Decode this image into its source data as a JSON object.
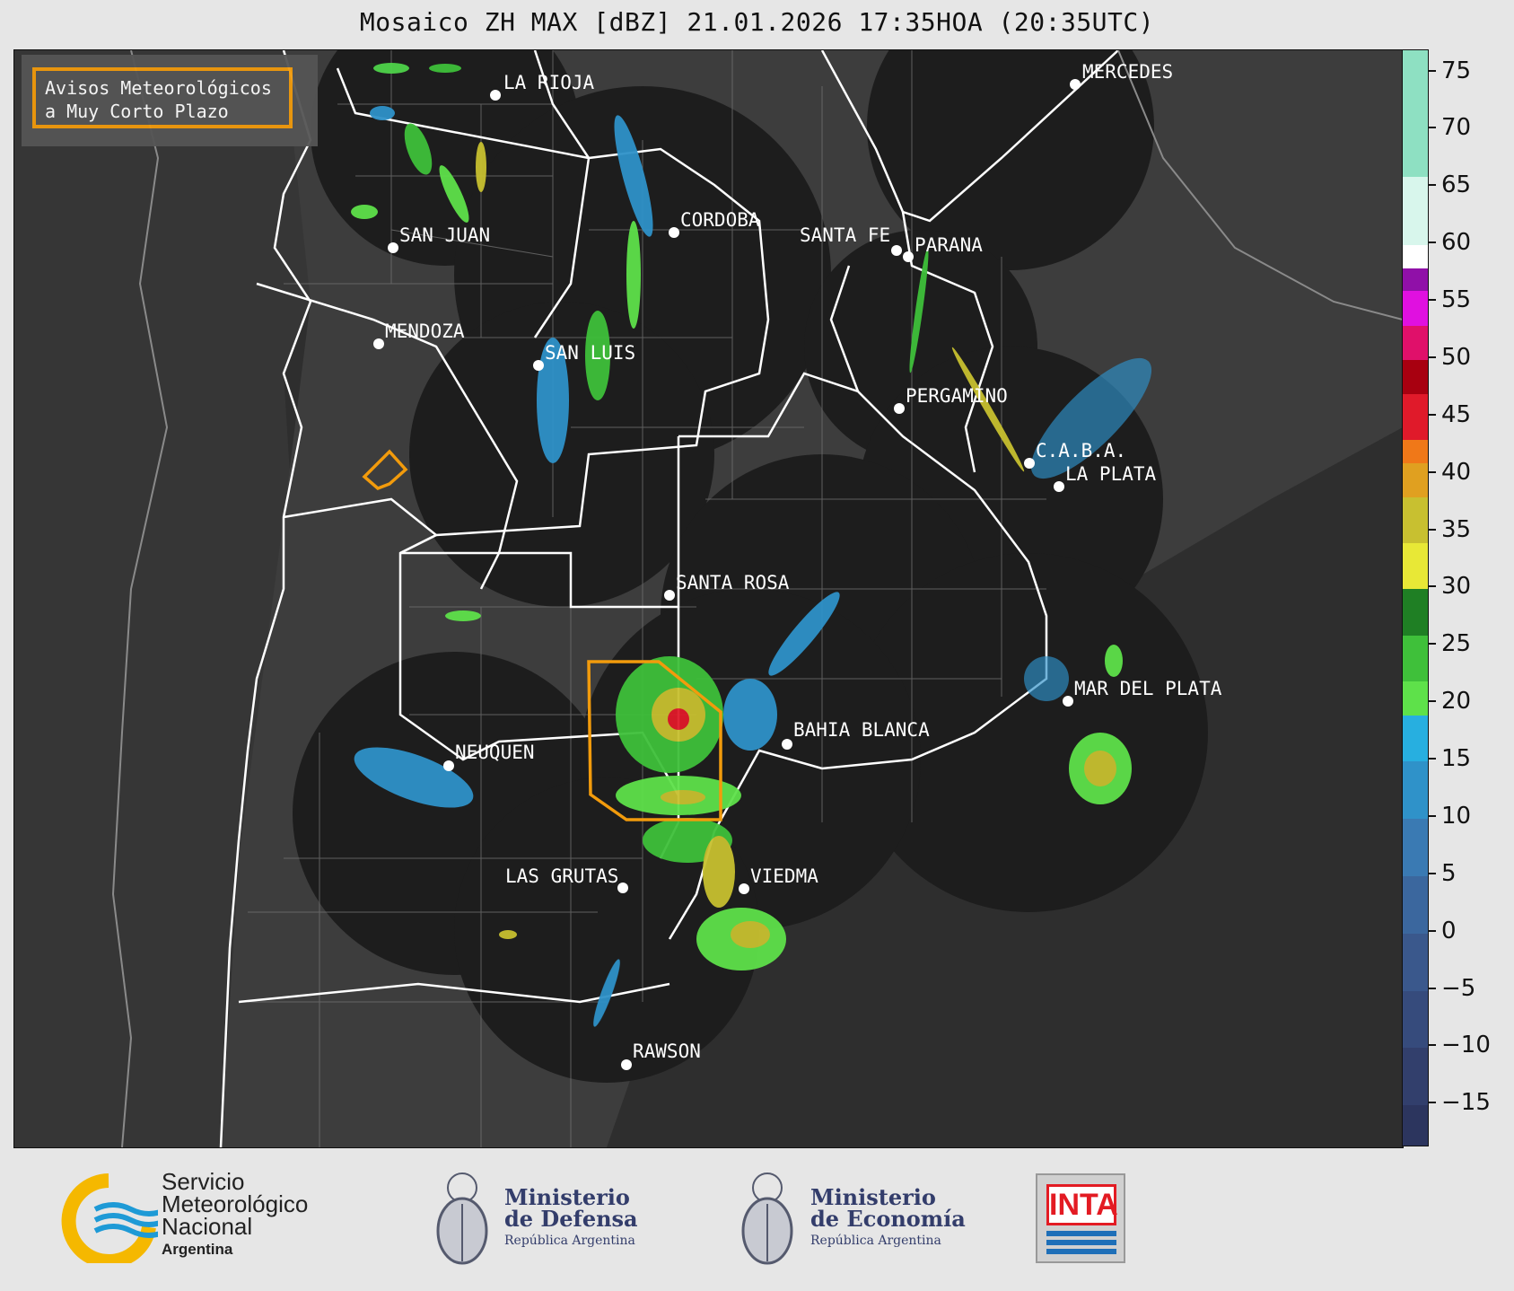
{
  "title": "Mosaico ZH MAX [dBZ] 21.01.2026 17:35HOA (20:35UTC)",
  "legend": {
    "line1": "Avisos Meteorológicos",
    "line2": "a Muy Corto Plazo",
    "color": "#f29b0c"
  },
  "colorbar": {
    "unit": "dBZ",
    "ticks": [
      "75",
      "70",
      "65",
      "60",
      "55",
      "50",
      "45",
      "40",
      "35",
      "30",
      "25",
      "20",
      "15",
      "10",
      "5",
      "0",
      "−5",
      "−10",
      "−15"
    ],
    "range": [
      -18.5,
      77
    ],
    "bands": [
      {
        "from": -18.5,
        "to": -15,
        "color": "#2c355e"
      },
      {
        "from": -15,
        "to": -10,
        "color": "#323f6c"
      },
      {
        "from": -10,
        "to": -5,
        "color": "#364b7c"
      },
      {
        "from": -5,
        "to": 0,
        "color": "#3a588c"
      },
      {
        "from": 0,
        "to": 5,
        "color": "#3b679e"
      },
      {
        "from": 5,
        "to": 10,
        "color": "#3a7ab3"
      },
      {
        "from": 10,
        "to": 15,
        "color": "#2f92c9"
      },
      {
        "from": 15,
        "to": 19,
        "color": "#27afe0"
      },
      {
        "from": 19,
        "to": 22,
        "color": "#5ee14a"
      },
      {
        "from": 22,
        "to": 26,
        "color": "#3fc03a"
      },
      {
        "from": 26,
        "to": 30,
        "color": "#1f7f24"
      },
      {
        "from": 30,
        "to": 34,
        "color": "#e8e836"
      },
      {
        "from": 34,
        "to": 38,
        "color": "#c8c030"
      },
      {
        "from": 38,
        "to": 41,
        "color": "#e0a020"
      },
      {
        "from": 41,
        "to": 43,
        "color": "#f07818"
      },
      {
        "from": 43,
        "to": 47,
        "color": "#e01a2a"
      },
      {
        "from": 47,
        "to": 50,
        "color": "#a80010"
      },
      {
        "from": 50,
        "to": 53,
        "color": "#e0106a"
      },
      {
        "from": 53,
        "to": 56,
        "color": "#e010e0"
      },
      {
        "from": 56,
        "to": 58,
        "color": "#9010a8"
      },
      {
        "from": 58,
        "to": 60,
        "color": "#ffffff"
      },
      {
        "from": 60,
        "to": 66,
        "color": "#d8f6ec"
      },
      {
        "from": 66,
        "to": 77,
        "color": "#8ee0c2"
      }
    ]
  },
  "cities": [
    {
      "name": "LA RIOJA"
    },
    {
      "name": "MERCEDES"
    },
    {
      "name": "SAN JUAN"
    },
    {
      "name": "CORDOBA"
    },
    {
      "name": "SANTA FE"
    },
    {
      "name": "PARANA"
    },
    {
      "name": "MENDOZA"
    },
    {
      "name": "SAN LUIS"
    },
    {
      "name": "PERGAMINO"
    },
    {
      "name": "C.A.B.A."
    },
    {
      "name": "LA PLATA"
    },
    {
      "name": "SANTA ROSA"
    },
    {
      "name": "MAR DEL PLATA"
    },
    {
      "name": "BAHIA BLANCA"
    },
    {
      "name": "NEUQUEN"
    },
    {
      "name": "LAS GRUTAS"
    },
    {
      "name": "VIEDMA"
    },
    {
      "name": "RAWSON"
    }
  ],
  "footer": {
    "smn": {
      "line1": "Servicio",
      "line2": "Meteorológico",
      "line3": "Nacional",
      "line4": "Argentina"
    },
    "defensa": {
      "line1": "Ministerio",
      "line2": "de Defensa",
      "line3": "República Argentina"
    },
    "economia": {
      "line1": "Ministerio",
      "line2": "de Economía",
      "line3": "República Argentina"
    },
    "inta": "INTA"
  }
}
